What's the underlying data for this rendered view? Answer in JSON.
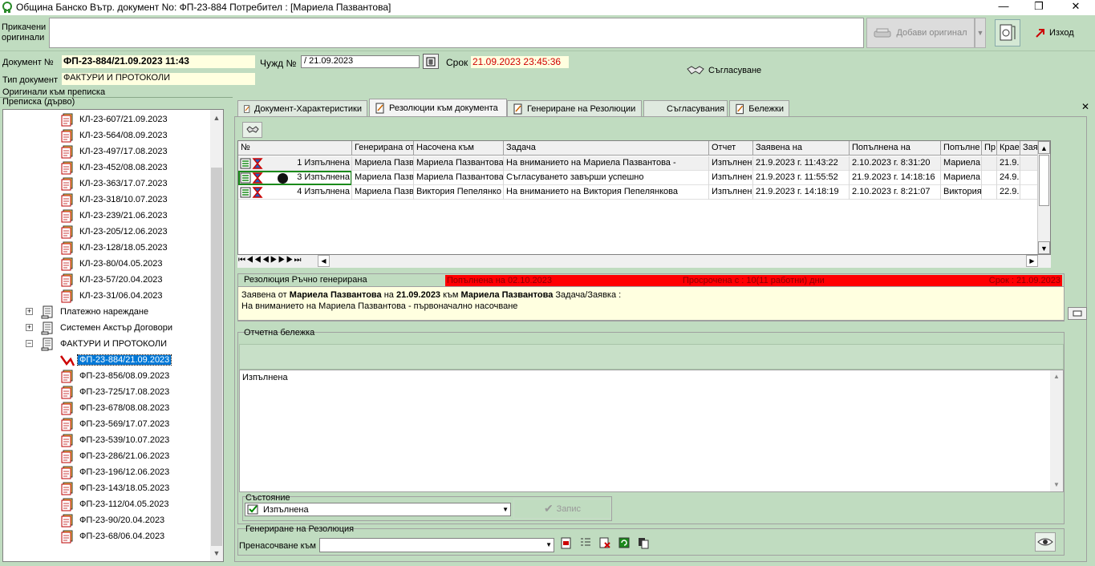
{
  "window": {
    "title": "Община Банско Вътр. документ No: ФП-23-884 Потребител : [Мариела Пазвантова]",
    "minimize": "—",
    "maximize": "❐",
    "close": "✕"
  },
  "attachments": {
    "label": "Прикачени оригинали",
    "add_button": "Добави оригинал",
    "exit_button": "Изход"
  },
  "document": {
    "no_label": "Документ №",
    "no_value": "ФП-23-884/21.09.2023 11:43",
    "type_label": "Тип документ",
    "type_value": "ФАКТУРИ И ПРОТОКОЛИ",
    "foreign_label": "Чужд №",
    "foreign_value": "/ 21.09.2023",
    "deadline_label": "Срок",
    "deadline_value": "21.09.2023 23:45:36",
    "approval_button": "Съгласуване"
  },
  "left": {
    "originals_label": "Оригинали към преписка",
    "tree_title": "Преписка (дърво)",
    "tree": [
      {
        "text": "КЛ-23-607/21.09.2023",
        "level": 2
      },
      {
        "text": "КЛ-23-564/08.09.2023",
        "level": 2
      },
      {
        "text": "КЛ-23-497/17.08.2023",
        "level": 2
      },
      {
        "text": "КЛ-23-452/08.08.2023",
        "level": 2
      },
      {
        "text": "КЛ-23-363/17.07.2023",
        "level": 2
      },
      {
        "text": "КЛ-23-318/10.07.2023",
        "level": 2
      },
      {
        "text": "КЛ-23-239/21.06.2023",
        "level": 2
      },
      {
        "text": "КЛ-23-205/12.06.2023",
        "level": 2
      },
      {
        "text": "КЛ-23-128/18.05.2023",
        "level": 2
      },
      {
        "text": "КЛ-23-80/04.05.2023",
        "level": 2
      },
      {
        "text": "КЛ-23-57/20.04.2023",
        "level": 2
      },
      {
        "text": "КЛ-23-31/06.04.2023",
        "level": 2
      },
      {
        "text": "Платежно нареждане",
        "level": 1,
        "expander": "+"
      },
      {
        "text": "Системен Акстър Договори",
        "level": 1,
        "expander": "+"
      },
      {
        "text": "ФАКТУРИ И ПРОТОКОЛИ",
        "level": 1,
        "expander": "−"
      },
      {
        "text": "ФП-23-884/21.09.2023",
        "level": 2,
        "selected": true
      },
      {
        "text": "ФП-23-856/08.09.2023",
        "level": 2
      },
      {
        "text": "ФП-23-725/17.08.2023",
        "level": 2
      },
      {
        "text": "ФП-23-678/08.08.2023",
        "level": 2
      },
      {
        "text": "ФП-23-569/17.07.2023",
        "level": 2
      },
      {
        "text": "ФП-23-539/10.07.2023",
        "level": 2
      },
      {
        "text": "ФП-23-286/21.06.2023",
        "level": 2
      },
      {
        "text": "ФП-23-196/12.06.2023",
        "level": 2
      },
      {
        "text": "ФП-23-143/18.05.2023",
        "level": 2
      },
      {
        "text": "ФП-23-112/04.05.2023",
        "level": 2
      },
      {
        "text": "ФП-23-90/20.04.2023",
        "level": 2
      },
      {
        "text": "ФП-23-68/06.04.2023",
        "level": 2
      }
    ]
  },
  "tabs": [
    {
      "label": "Документ-Характеристики",
      "icon": "document-edit-icon"
    },
    {
      "label": "Резолюции към документа",
      "icon": "resolution-icon",
      "active": true
    },
    {
      "label": "Генериране на Резолюции",
      "icon": "generate-icon"
    },
    {
      "label": "Съгласувания",
      "icon": "none"
    },
    {
      "label": "Бележки",
      "icon": "notes-icon"
    }
  ],
  "grid": {
    "columns": [
      "№",
      "Генерирана от",
      "Насочена към",
      "Задача",
      "Отчет",
      "Заявена на",
      "Попълнена на",
      "Попълне",
      "Пр",
      "Крае",
      "Зая"
    ],
    "rows": [
      [
        "1 Изпълнена",
        "Мариела Пазвантова",
        "Мариела Пазвантова",
        "На вниманието на Мариела Пазвантова -",
        "Изпълнена",
        "21.9.2023 г. 11:43:22",
        "2.10.2023 г. 8:31:20",
        "Мариела",
        "",
        "21.9.",
        ""
      ],
      [
        "3 Изпълнена",
        "Мариела Пазвантова",
        "Мариела Пазвантова",
        "Съгласуването завърши успешно",
        "Изпълнена",
        "21.9.2023 г. 11:55:52",
        "21.9.2023 г. 14:18:16",
        "Мариела",
        "",
        "24.9.",
        ""
      ],
      [
        "4 Изпълнена",
        "Мариела Пазвантова",
        "Виктория Пепелянко",
        "На вниманието на  Виктория Пепелянкова",
        "Изпълнена",
        "21.9.2023 г. 14:18:19",
        "2.10.2023 г. 8:21:07",
        "Виктория",
        "",
        "22.9.",
        ""
      ]
    ]
  },
  "resolution": {
    "label": "Резолюция Ръчно генерирана",
    "filled": "Попълнена на 02.10.2023",
    "overdue": "Просрочена с : 10(11 работни) дни",
    "deadline": "Срок : 21.09.2023",
    "line1_prefix": "Заявена от",
    "line1_name": "Мариела Пазвантова",
    "line1_on": "на",
    "line1_date": "21.09.2023",
    "line1_to": "към",
    "line1_target": "Мариела Пазвантова",
    "line1_suffix": "Задача/Заявка :",
    "line2": "На вниманието на Мариела Пазвантова - първоначално насочване"
  },
  "note": {
    "label": "Отчетна бележка",
    "text": "Изпълнена"
  },
  "state": {
    "label": "Състояние",
    "value": "Изпълнена",
    "save_button": "Запис"
  },
  "generation": {
    "label": "Генериране на Резолюция",
    "redirect_label": "Пренасочване към"
  }
}
